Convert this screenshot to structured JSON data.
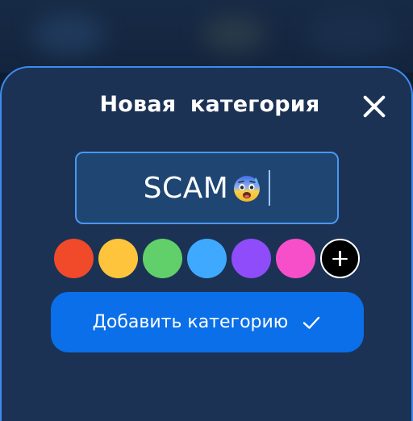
{
  "colors": {
    "background": "#0f1d33",
    "dialog": "#1b3254",
    "dialog_border": "#3e8cf0",
    "accent": "#0a6fe8"
  },
  "dialog": {
    "title_part1": "Новая",
    "title_part2": "категория",
    "close_icon": "close-icon"
  },
  "category_input": {
    "value": "SCAM",
    "emoji_icon": "anxious-face-with-sweat-emoji"
  },
  "color_palette": {
    "swatches": [
      {
        "name": "red",
        "color": "#f04a2a"
      },
      {
        "name": "yellow",
        "color": "#fdc43c"
      },
      {
        "name": "green",
        "color": "#62d06a"
      },
      {
        "name": "blue",
        "color": "#3fa9ff"
      },
      {
        "name": "purple",
        "color": "#8f4cfa"
      },
      {
        "name": "pink",
        "color": "#f64fc9"
      }
    ],
    "add_icon": "plus-icon"
  },
  "submit": {
    "label": "Добавить категорию",
    "icon": "check-icon"
  }
}
